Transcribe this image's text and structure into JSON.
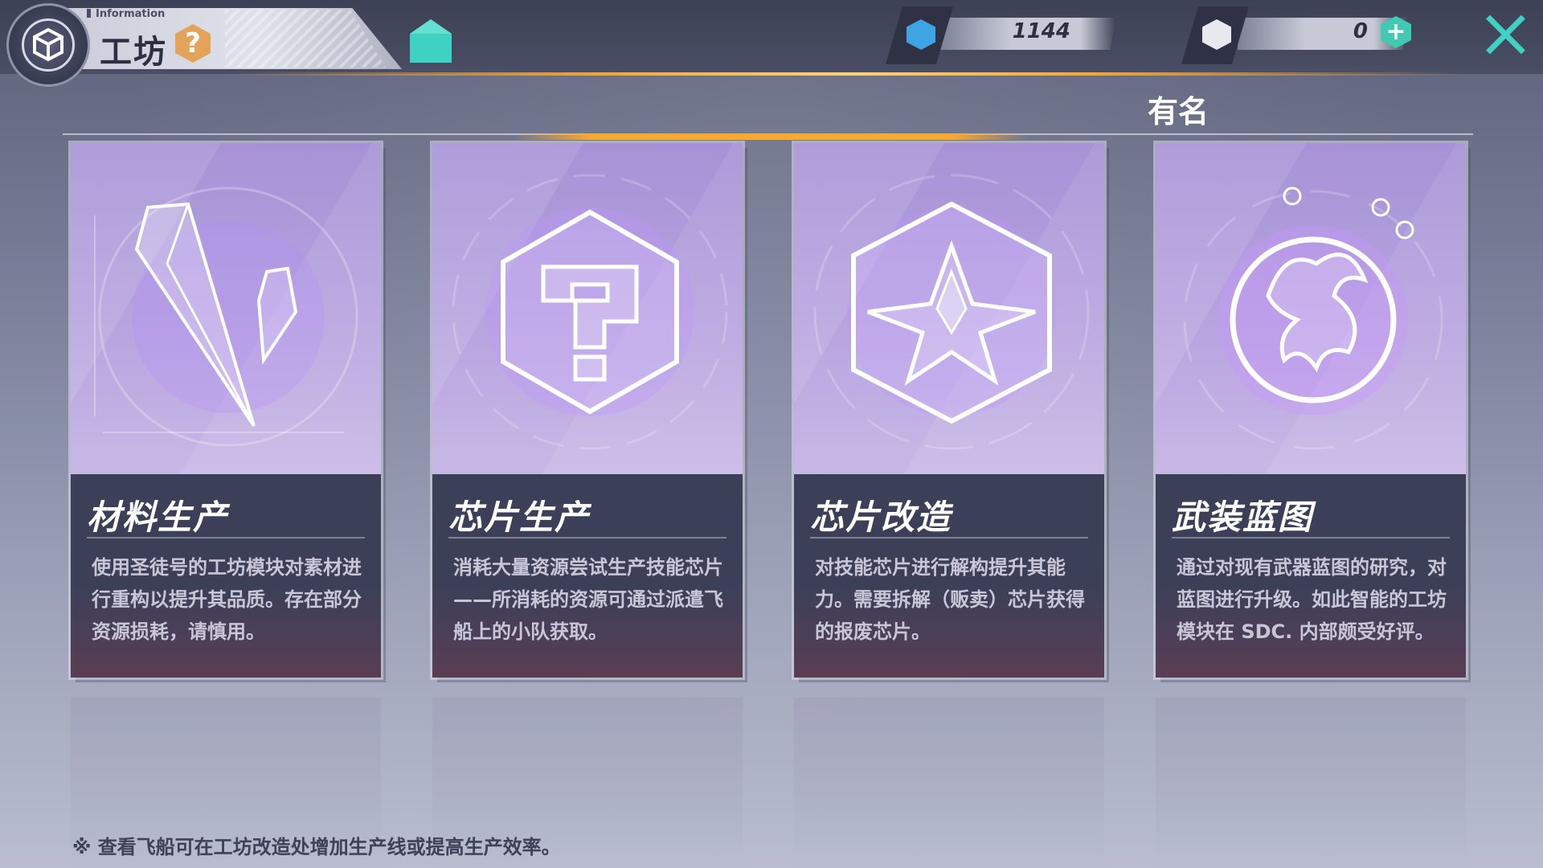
{
  "header": {
    "info_tag": "Information",
    "title": "工坊",
    "help_symbol": "?",
    "username": "有名"
  },
  "currencies": [
    {
      "icon": "blue-gem-icon",
      "value": "1144"
    },
    {
      "icon": "chip-token-icon",
      "value": "0",
      "plus": "+"
    }
  ],
  "cards": [
    {
      "title": "材料生产",
      "description": "使用圣徒号的工坊模块对素材进行重构以提升其品质。存在部分资源损耗，请慎用。",
      "icon": "crystal-icon"
    },
    {
      "title": "芯片生产",
      "description": "消耗大量资源尝试生产技能芯片——所消耗的资源可通过派遣飞船上的小队获取。",
      "icon": "question-chip-icon"
    },
    {
      "title": "芯片改造",
      "description": "对技能芯片进行解构提升其能力。需要拆解（贩卖）芯片获得的报废芯片。",
      "icon": "star-emblem-icon"
    },
    {
      "title": "武装蓝图",
      "description": "通过对现有武器蓝图的研究，对蓝图进行升级。如此智能的工坊模块在 SDC. 内部颇受好评。",
      "icon": "dragon-emblem-icon"
    }
  ],
  "footnote": "※ 查看飞船可在工坊改造处增加生产线或提高生产效率。",
  "colors": {
    "accent_teal": "#3fd2c3",
    "accent_gold": "#f6aa33",
    "card_art": "#b9a6df",
    "card_info": "#3c3f58"
  }
}
